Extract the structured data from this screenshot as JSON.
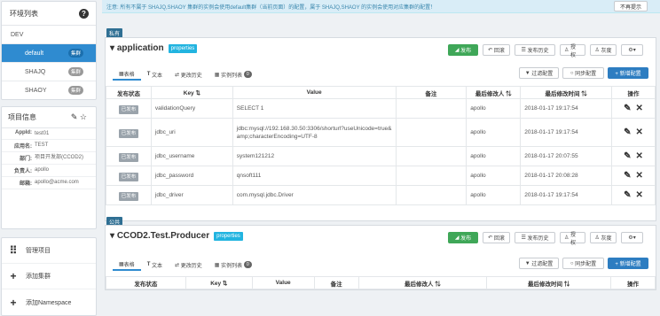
{
  "sidebar": {
    "env_title": "环境列表",
    "env_name": "DEV",
    "clusters": [
      {
        "label": "default",
        "badge": "集群"
      },
      {
        "label": "SHAJQ",
        "badge": "集群"
      },
      {
        "label": "SHAOY",
        "badge": "集群"
      }
    ],
    "info_title": "项目信息",
    "info": [
      {
        "label": "AppId:",
        "value": "test01"
      },
      {
        "label": "应用名:",
        "value": "TEST"
      },
      {
        "label": "部门:",
        "value": "项目开发部(CCOD2)"
      },
      {
        "label": "负责人:",
        "value": "apollo"
      },
      {
        "label": "邮箱:",
        "value": "apollo@acme.com"
      }
    ],
    "actions": [
      {
        "label": "管理项目",
        "icon": "⠿"
      },
      {
        "label": "添加集群",
        "icon": "+"
      },
      {
        "label": "添加Namespace",
        "icon": "+"
      }
    ]
  },
  "notice": {
    "text": "注意: 所有不属于 SHAJQ,SHAOY 集群的实例会使用default集群（当前页面）的配置，属于 SHAJQ,SHAOY 的实例会使用对应集群的配置！",
    "dismiss": "不再提示"
  },
  "ns1": {
    "scope": "私有",
    "name": "application",
    "format": "properties",
    "buttons": {
      "publish": "发布",
      "rollback": "回滚",
      "history": "发布历史",
      "auth": "授权",
      "gray": "灰度",
      "more": "⚙"
    },
    "tabs": [
      "表格",
      "文本",
      "更改历史",
      "实例列表"
    ],
    "instance_count": "0",
    "filter": "过滤配置",
    "sync": "同步配置",
    "add": "+ 新增配置",
    "columns": [
      "发布状态",
      "Key ⇅",
      "Value",
      "备注",
      "最后修改人 ⇅",
      "最后修改时间 ⇅",
      "操作"
    ],
    "rows": [
      {
        "status": "已发布",
        "key": "validationQuery",
        "value": "SELECT 1",
        "note": "",
        "user": "apollo",
        "time": "2018-01-17 19:17:54"
      },
      {
        "status": "已发布",
        "key": "jdbc_uri",
        "value": "jdbc:mysql://192.168.30.50:3306/shorturl?useUnicode=true&amp;characterEncoding=UTF-8",
        "note": "",
        "user": "apollo",
        "time": "2018-01-17 19:17:54"
      },
      {
        "status": "已发布",
        "key": "jdbc_username",
        "value": "system121212",
        "note": "",
        "user": "apollo",
        "time": "2018-01-17 20:07:55"
      },
      {
        "status": "已发布",
        "key": "jdbc_password",
        "value": "qnsoft111",
        "note": "",
        "user": "apollo",
        "time": "2018-01-17 20:08:28"
      },
      {
        "status": "已发布",
        "key": "jdbc_driver",
        "value": "com.mysql.jdbc.Driver",
        "note": "",
        "user": "apollo",
        "time": "2018-01-17 19:17:54"
      }
    ]
  },
  "ns2": {
    "scope": "公共",
    "name": "CCOD2.Test.Producer",
    "format": "properties",
    "buttons": {
      "publish": "发布",
      "rollback": "回滚",
      "history": "发布历史",
      "auth": "授权",
      "gray": "灰度",
      "more": "⚙"
    },
    "tabs": [
      "表格",
      "文本",
      "更改历史",
      "实例列表"
    ],
    "instance_count": "0",
    "filter": "过滤配置",
    "sync": "同步配置",
    "add": "+ 新增配置",
    "columns": [
      "发布状态",
      "Key ⇅",
      "Value",
      "备注",
      "最后修改人 ⇅",
      "最后修改时间 ⇅",
      "操作"
    ]
  }
}
